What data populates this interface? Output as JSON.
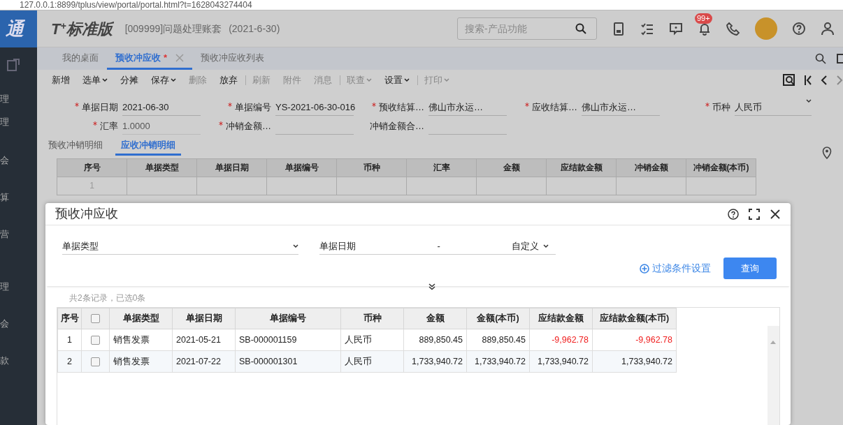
{
  "address_bar": {
    "url": "127.0.0.1:8899/tplus/view/portal/portal.html?t=1628043274404"
  },
  "sidebar": {
    "logo": "通",
    "items": [
      "理",
      "理",
      "会",
      "算",
      "营",
      "理",
      "会",
      "款"
    ]
  },
  "header": {
    "product": "T$^{+}$标准版",
    "account": "[009999]问题处理账套",
    "date": "(2021-6-30)",
    "search": {
      "placeholder": "搜索-产品功能"
    },
    "badge": "99+"
  },
  "tabs": [
    {
      "label": "我的桌面",
      "selected": false
    },
    {
      "label": "预收冲应收",
      "selected": true,
      "mark": "*",
      "closable": true
    },
    {
      "label": "预收冲应收列表",
      "selected": false
    }
  ],
  "toolbar": [
    {
      "label": "新增",
      "disabled": false,
      "dropdown": false,
      "separator_before": false
    },
    {
      "label": "选单",
      "disabled": false,
      "dropdown": true,
      "separator_before": false
    },
    {
      "label": "分摊",
      "disabled": false,
      "dropdown": false,
      "separator_before": false
    },
    {
      "label": "保存",
      "disabled": false,
      "dropdown": true,
      "separator_before": false
    },
    {
      "label": "删除",
      "disabled": true,
      "dropdown": false,
      "separator_before": false
    },
    {
      "label": "放弃",
      "disabled": false,
      "dropdown": false,
      "separator_before": false
    },
    {
      "label": "刷新",
      "disabled": true,
      "dropdown": false,
      "separator_before": true
    },
    {
      "label": "附件",
      "disabled": true,
      "dropdown": false,
      "separator_before": false
    },
    {
      "label": "消息",
      "disabled": true,
      "dropdown": false,
      "separator_before": false
    },
    {
      "label": "联查",
      "disabled": true,
      "dropdown": true,
      "separator_before": true
    },
    {
      "label": "设置",
      "disabled": false,
      "dropdown": true,
      "separator_before": false
    },
    {
      "label": "打印",
      "disabled": true,
      "dropdown": true,
      "separator_before": true
    }
  ],
  "form": {
    "rows": [
      [
        {
          "label": "单据日期",
          "required": true,
          "value": "2021-06-30",
          "kind": "text",
          "disabled": false
        },
        {
          "label": "单据编号",
          "required": true,
          "value": "YS-2021-06-30-016",
          "kind": "text",
          "disabled": false
        },
        {
          "label": "预收结算…",
          "required": true,
          "value": "佛山市永运…",
          "kind": "text",
          "disabled": false
        },
        {
          "label": "应收结算…",
          "required": true,
          "value": "佛山市永运…",
          "kind": "text",
          "disabled": false
        },
        {
          "label": "币种",
          "required": true,
          "value": "人民币",
          "kind": "select",
          "disabled": false
        }
      ],
      [
        {
          "label": "汇率",
          "required": true,
          "value": "1.0000",
          "kind": "text",
          "disabled": true
        },
        {
          "label": "冲销金额…",
          "required": true,
          "kind": "text",
          "disabled": false
        },
        {
          "label": "冲销金额合…",
          "required": false,
          "kind": "text",
          "disabled": false
        }
      ]
    ]
  },
  "detail_tabs": [
    {
      "label": "预收冲销明细",
      "selected": false
    },
    {
      "label": "应收冲销明细",
      "selected": true
    }
  ],
  "grid": {
    "columns": [
      "序号",
      "单据类型",
      "单据日期",
      "单据编号",
      "币种",
      "汇率",
      "金额",
      "应结款金额",
      "冲销金额",
      "冲销金额(本币)"
    ],
    "rows": [
      [
        "1"
      ]
    ]
  },
  "dialog": {
    "title": "预收冲应收",
    "filters": [
      {
        "kind": "select",
        "label": "单据类型"
      },
      {
        "kind": "date_range",
        "label": "单据日期",
        "separator": "-",
        "range": "自定义"
      }
    ],
    "filter_settings": "过滤条件设置",
    "query_button": "查询",
    "summary": "共2条记录，已选0条",
    "table": {
      "columns": [
        "序号",
        "单据类型",
        "单据日期",
        "单据编号",
        "币种",
        "金额",
        "金额(本币)",
        "应结款金额",
        "应结款金额(本币)"
      ],
      "all_checked": false,
      "rows": [
        {
          "cells": [
            "1",
            "销售发票",
            "2021-05-21",
            "SB-000001159",
            "人民币",
            "889,850.45",
            "889,850.45",
            "-9,962.78",
            "-9,962.78"
          ],
          "checked": false,
          "negative": true
        },
        {
          "cells": [
            "2",
            "销售发票",
            "2021-07-22",
            "SB-000001301",
            "人民币",
            "1,733,940.72",
            "1,733,940.72",
            "1,733,940.72",
            "1,733,940.72"
          ],
          "checked": false,
          "negative": false
        }
      ]
    }
  }
}
